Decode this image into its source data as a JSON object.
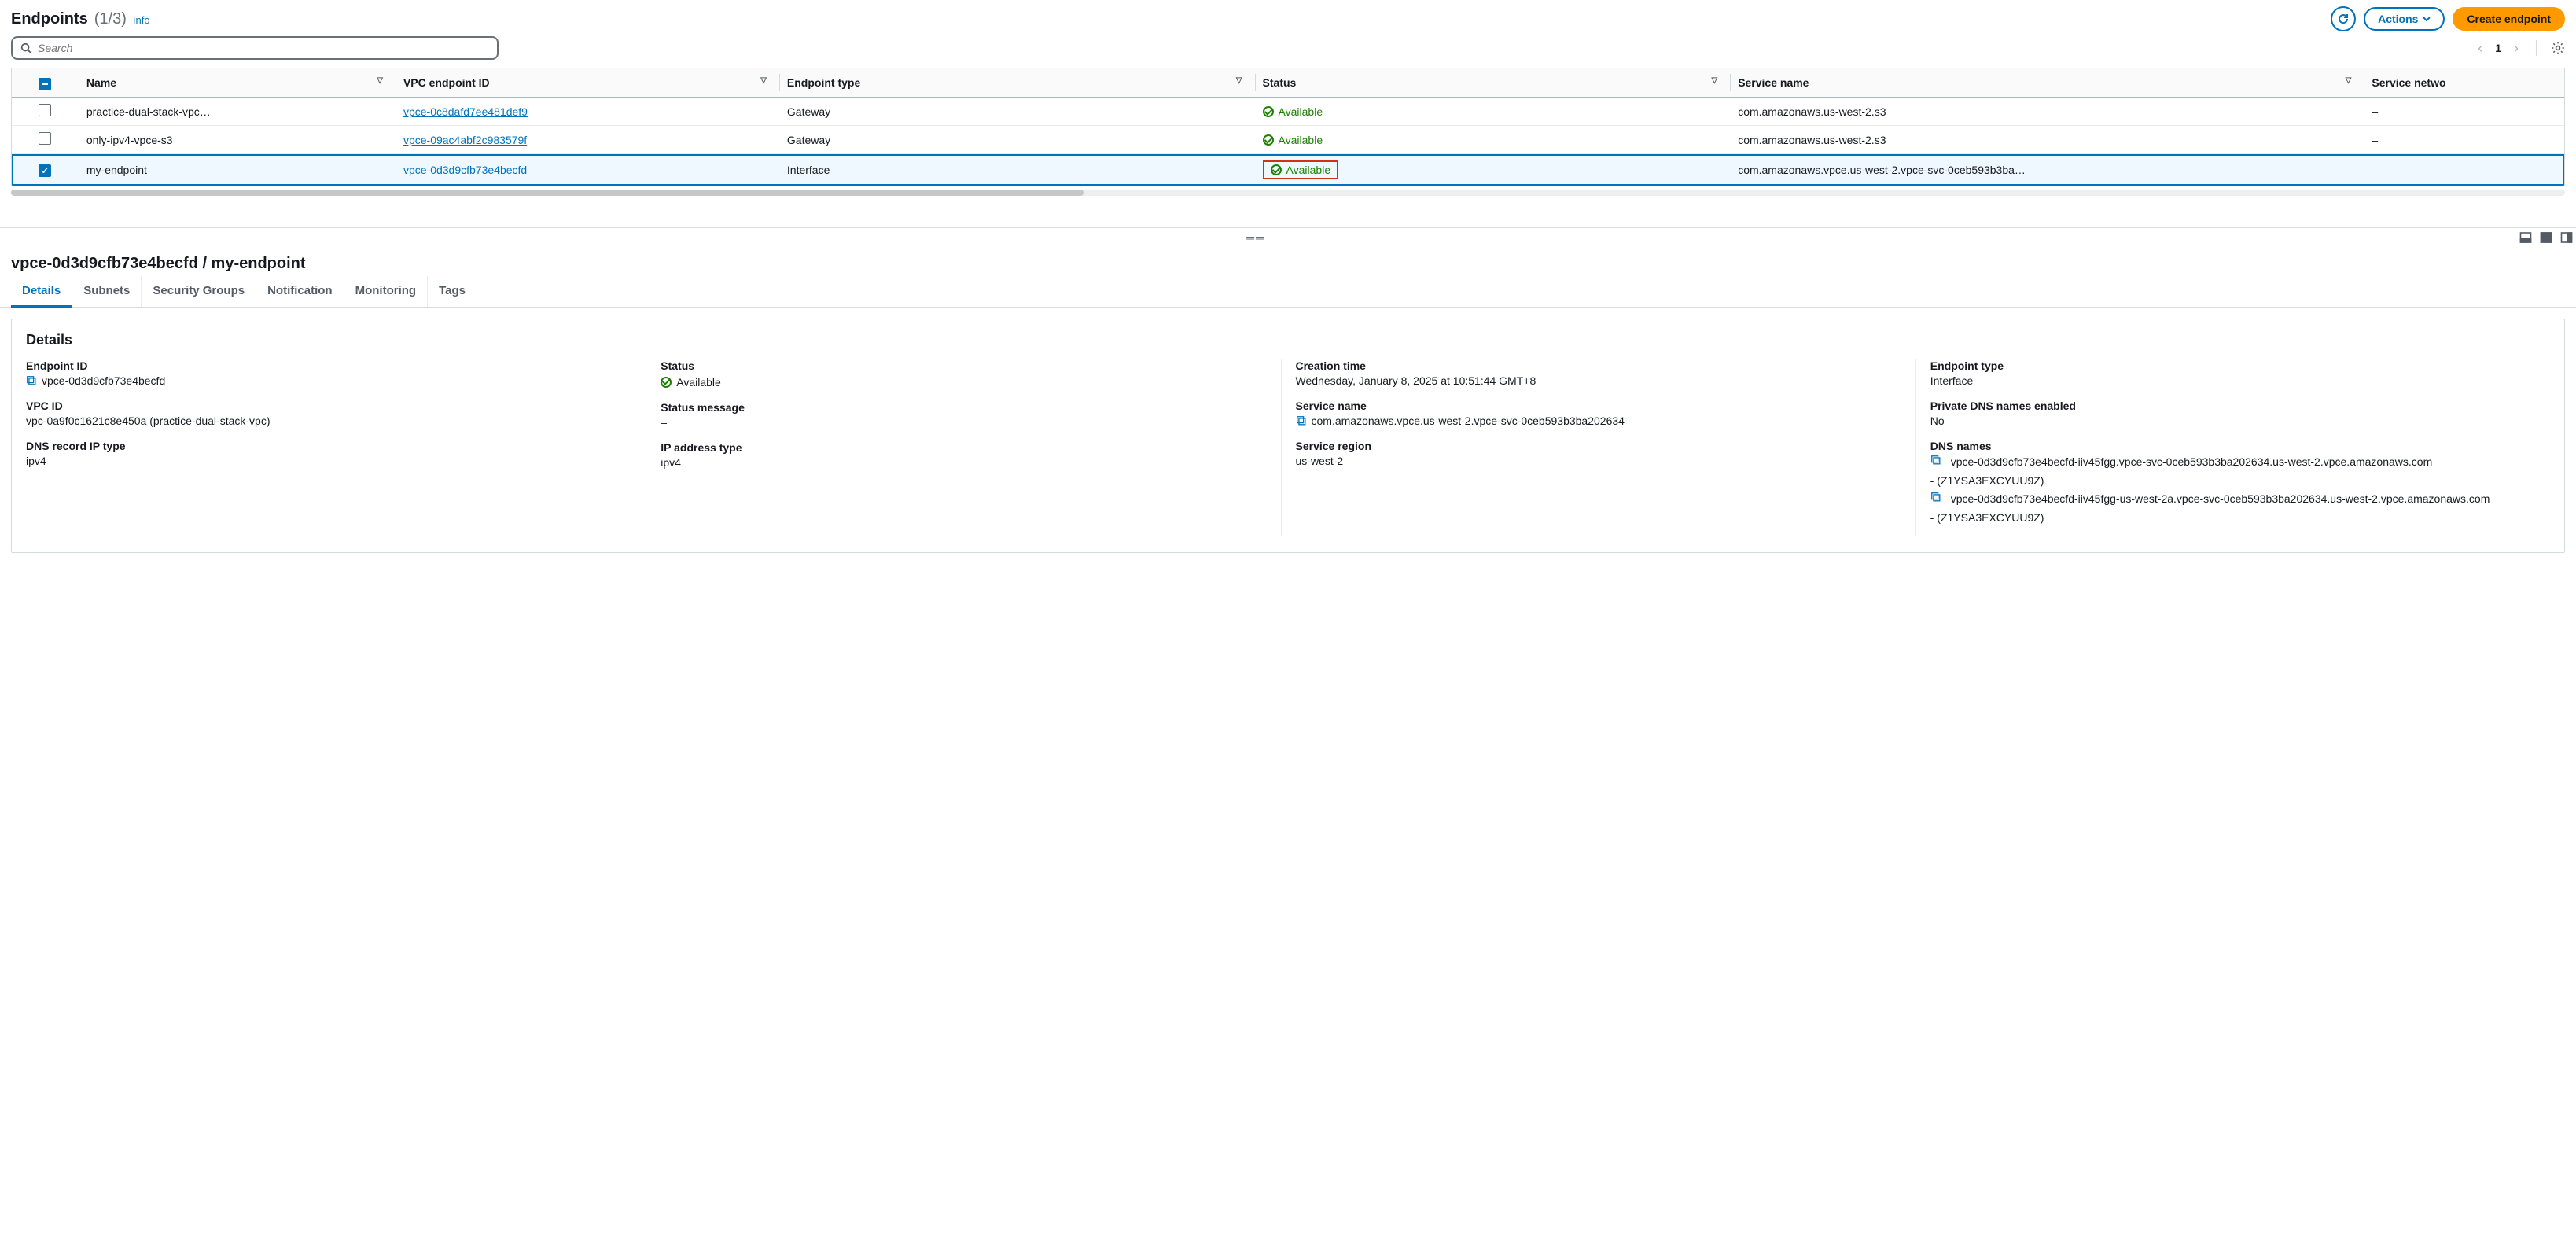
{
  "header": {
    "title": "Endpoints",
    "count": "(1/3)",
    "info": "Info",
    "actions": "Actions",
    "create": "Create endpoint"
  },
  "search": {
    "placeholder": "Search"
  },
  "pagination": {
    "page": "1"
  },
  "table": {
    "columns": {
      "name": "Name",
      "vpc_endpoint_id": "VPC endpoint ID",
      "endpoint_type": "Endpoint type",
      "status": "Status",
      "service_name": "Service name",
      "service_netwo": "Service netwo"
    },
    "rows": [
      {
        "selected": false,
        "name": "practice-dual-stack-vpc…",
        "vpc_endpoint_id": "vpce-0c8dafd7ee481def9",
        "endpoint_type": "Gateway",
        "status": "Available",
        "status_boxed": false,
        "service_name": "com.amazonaws.us-west-2.s3",
        "service_netwo": "–"
      },
      {
        "selected": false,
        "name": "only-ipv4-vpce-s3",
        "vpc_endpoint_id": "vpce-09ac4abf2c983579f",
        "endpoint_type": "Gateway",
        "status": "Available",
        "status_boxed": false,
        "service_name": "com.amazonaws.us-west-2.s3",
        "service_netwo": "–"
      },
      {
        "selected": true,
        "name": "my-endpoint",
        "vpc_endpoint_id": "vpce-0d3d9cfb73e4becfd",
        "endpoint_type": "Interface",
        "status": "Available",
        "status_boxed": true,
        "service_name": "com.amazonaws.vpce.us-west-2.vpce-svc-0ceb593b3ba…",
        "service_netwo": "–"
      }
    ]
  },
  "split": {
    "heading": "vpce-0d3d9cfb73e4becfd / my-endpoint"
  },
  "tabs": [
    {
      "label": "Details",
      "active": true
    },
    {
      "label": "Subnets",
      "active": false
    },
    {
      "label": "Security Groups",
      "active": false
    },
    {
      "label": "Notification",
      "active": false
    },
    {
      "label": "Monitoring",
      "active": false
    },
    {
      "label": "Tags",
      "active": false
    }
  ],
  "details": {
    "panel_title": "Details",
    "col1": {
      "endpoint_id_label": "Endpoint ID",
      "endpoint_id": "vpce-0d3d9cfb73e4becfd",
      "vpc_id_label": "VPC ID",
      "vpc_id": "vpc-0a9f0c1621c8e450a (practice-dual-stack-vpc)",
      "dns_record_ip_type_label": "DNS record IP type",
      "dns_record_ip_type": "ipv4"
    },
    "col2": {
      "status_label": "Status",
      "status": "Available",
      "status_message_label": "Status message",
      "status_message": "–",
      "ip_address_type_label": "IP address type",
      "ip_address_type": "ipv4"
    },
    "col3": {
      "creation_time_label": "Creation time",
      "creation_time": "Wednesday, January 8, 2025 at 10:51:44 GMT+8",
      "service_name_label": "Service name",
      "service_name": "com.amazonaws.vpce.us-west-2.vpce-svc-0ceb593b3ba202634",
      "service_region_label": "Service region",
      "service_region": "us-west-2"
    },
    "col4": {
      "endpoint_type_label": "Endpoint type",
      "endpoint_type": "Interface",
      "private_dns_label": "Private DNS names enabled",
      "private_dns": "No",
      "dns_names_label": "DNS names",
      "dns1": "vpce-0d3d9cfb73e4becfd-iiv45fgg.vpce-svc-0ceb593b3ba202634.us-west-2.vpce.amazonaws.com",
      "dns1_zone": "- (Z1YSA3EXCYUU9Z)",
      "dns2": "vpce-0d3d9cfb73e4becfd-iiv45fgg-us-west-2a.vpce-svc-0ceb593b3ba202634.us-west-2.vpce.amazonaws.com",
      "dns2_zone": "- (Z1YSA3EXCYUU9Z)"
    }
  }
}
